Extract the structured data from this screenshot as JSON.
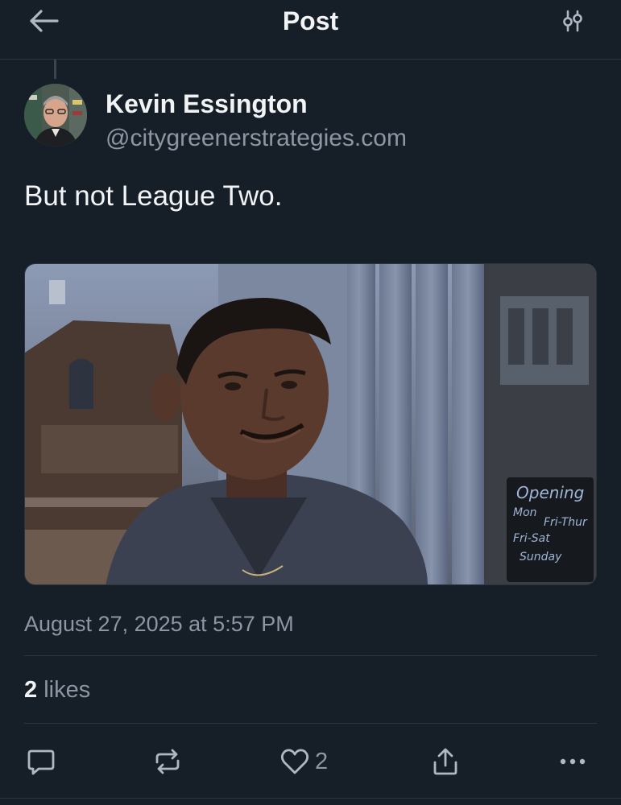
{
  "header": {
    "title": "Post",
    "back_icon": "arrow-left-icon",
    "filter_icon": "sliders-icon"
  },
  "post": {
    "author": {
      "name": "Kevin Essington",
      "handle": "@citygreenerstrategies.com"
    },
    "text": "But not League Two.",
    "media": {
      "sign_lines": [
        "Opening",
        "Mon",
        "Fri-Thur",
        "Fri-Sat",
        "Sunday"
      ]
    },
    "timestamp": "August 27, 2025 at 5:57 PM",
    "likes": {
      "count": "2",
      "label": "likes"
    },
    "actions": {
      "like_count": "2"
    }
  },
  "colors": {
    "background": "#161e27",
    "text_primary": "#f1f3f5",
    "text_secondary": "#8c97a3",
    "divider": "#2c3641"
  }
}
